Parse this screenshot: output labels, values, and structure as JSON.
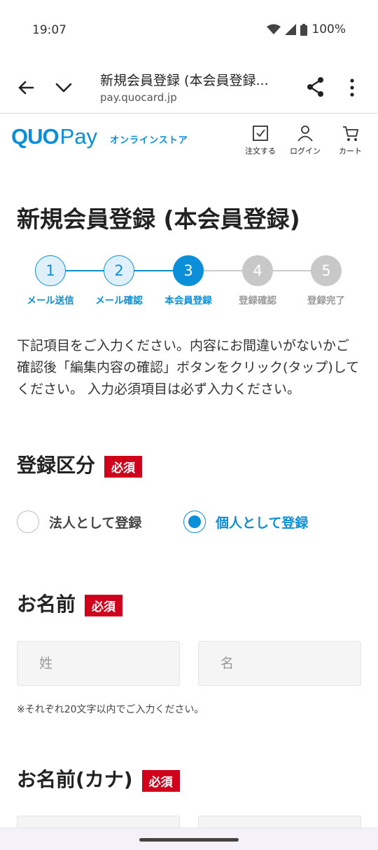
{
  "status": {
    "time": "19:07",
    "battery": "100%"
  },
  "browser": {
    "title": "新規会員登録 (本会員登録...",
    "url": "pay.quocard.jp"
  },
  "site": {
    "logo_main": "QUO",
    "logo_pay": "Pay",
    "logo_sub": "オンラインストア",
    "nav": {
      "order": "注文する",
      "login": "ログイン",
      "cart": "カート"
    }
  },
  "page": {
    "title": "新規会員登録 (本会員登録)",
    "steps": [
      {
        "num": "1",
        "label": "メール送信",
        "state": "done"
      },
      {
        "num": "2",
        "label": "メール確認",
        "state": "done"
      },
      {
        "num": "3",
        "label": "本会員登録",
        "state": "current"
      },
      {
        "num": "4",
        "label": "登録確認",
        "state": "todo"
      },
      {
        "num": "5",
        "label": "登録完了",
        "state": "todo"
      }
    ],
    "intro": "下記項目をご入力ください。内容にお間違いがないかご確認後「編集内容の確認」ボタンをクリック(タップ)してください。 入力必須項目は必ず入力ください。",
    "required_label": "必須",
    "registration_type": {
      "title": "登録区分",
      "options": [
        {
          "label": "法人として登録",
          "selected": false
        },
        {
          "label": "個人として登録",
          "selected": true
        }
      ]
    },
    "name": {
      "title": "お名前",
      "last_placeholder": "姓",
      "first_placeholder": "名",
      "note": "※それぞれ20文字以内でご入力ください。"
    },
    "kana": {
      "title": "お名前(カナ)"
    }
  },
  "colors": {
    "accent": "#0a8fd8",
    "required": "#d0021b",
    "inactive": "#c8c8c8"
  }
}
